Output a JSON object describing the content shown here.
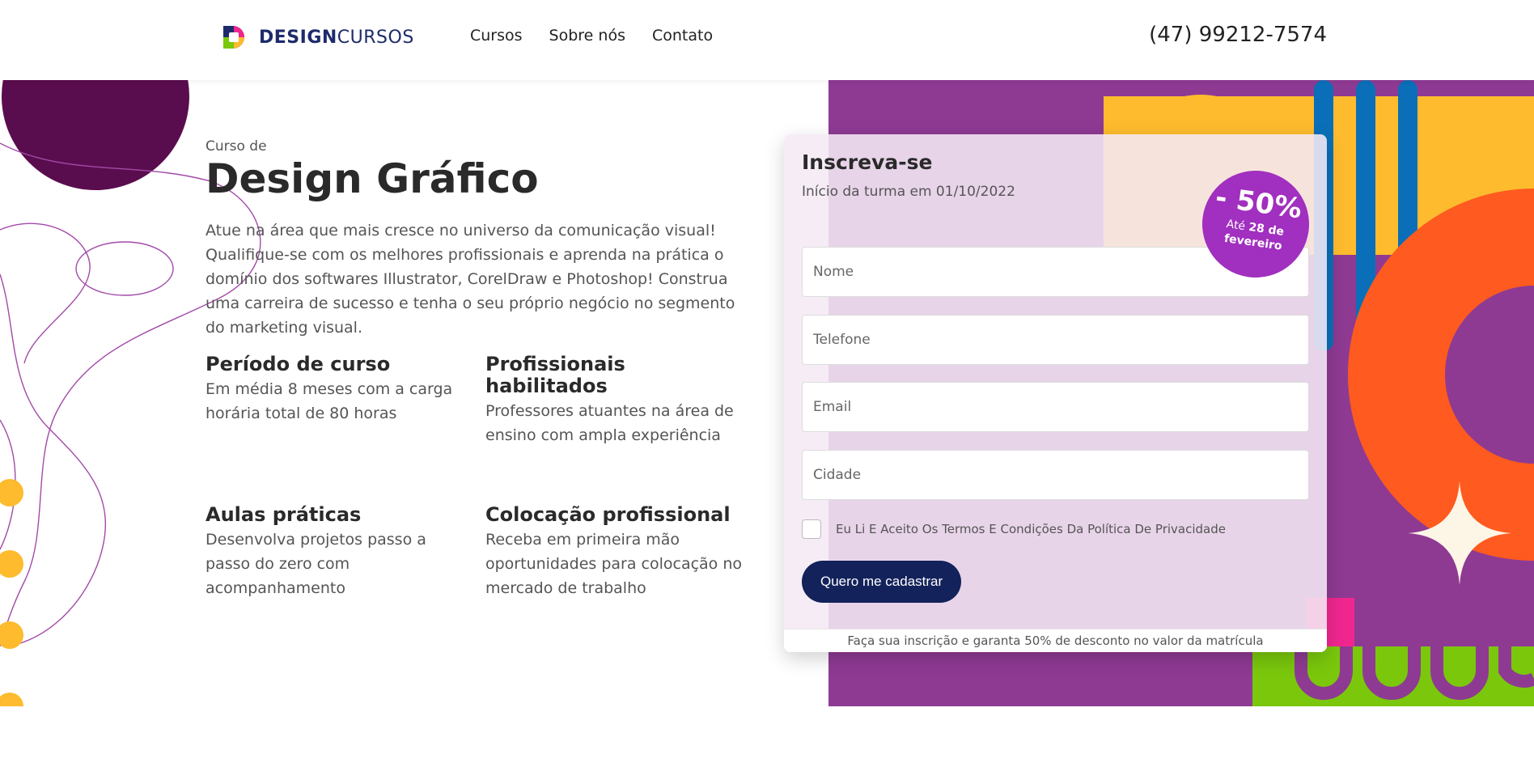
{
  "header": {
    "logo": {
      "bold": "DESIGN",
      "light": "CURSOS"
    },
    "nav": [
      {
        "label": "Cursos"
      },
      {
        "label": "Sobre nós"
      },
      {
        "label": "Contato"
      }
    ],
    "phone": "(47) 99212-7574"
  },
  "hero": {
    "kicker": "Curso de",
    "title": "Design Gráfico",
    "description": "Atue na área que mais cresce no universo da comunicação visual! Qualifique-se com os melhores profissionais e aprenda na prática o domínio dos softwares Illustrator, CorelDraw e Photoshop! Construa uma carreira de sucesso e tenha o seu próprio negócio no segmento do marketing visual.",
    "features": [
      {
        "title": "Período de curso",
        "text": "Em média 8 meses com a carga horária total de 80 horas"
      },
      {
        "title": "Profissionais habilitados",
        "text": "Professores atuantes na área de ensino com ampla experiência"
      },
      {
        "title": "Aulas práticas",
        "text": "Desenvolva projetos passo a passo do zero com acompanhamento"
      },
      {
        "title": "Colocação profissional",
        "text": "Receba em primeira mão oportunidades para colocação no mercado de trabalho"
      }
    ]
  },
  "form": {
    "title": "Inscreva-se",
    "subtitle": "Início da turma em 01/10/2022",
    "fields": [
      {
        "placeholder": "Nome",
        "value": ""
      },
      {
        "placeholder": "Telefone",
        "value": ""
      },
      {
        "placeholder": "Email",
        "value": ""
      },
      {
        "placeholder": "Cidade",
        "value": ""
      }
    ],
    "terms_label": "Eu Li E Aceito Os Termos E Condições Da Política De Privacidade",
    "terms_checked": false,
    "submit_label": "Quero me cadastrar",
    "footer_note": "Faça sua inscrição e garanta 50% de desconto no valor da matrícula"
  },
  "badge": {
    "discount": "- 50%",
    "until_prefix": "Até",
    "until_date": "28 de fevereiro"
  },
  "colors": {
    "navy": "#13225a",
    "purple": "#8e3a93",
    "dark_purple": "#5a0d4e",
    "orange": "#ff5a1f",
    "yellow": "#fdbb2d",
    "blue": "#0a6fb8",
    "green": "#7ac70c",
    "pink": "#f0268f",
    "badge": "#a12fbf"
  }
}
